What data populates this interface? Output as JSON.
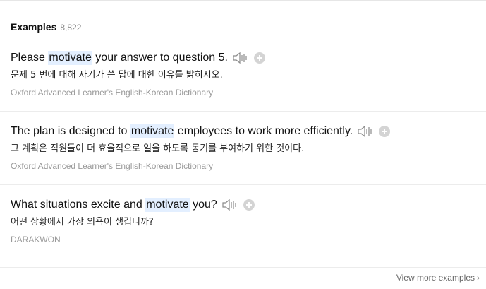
{
  "header": {
    "title": "Examples",
    "count": "8,822"
  },
  "examples": [
    {
      "before": "Please ",
      "highlight": "motivate",
      "after": " your answer to question 5.",
      "translation": "문제 5 번에 대해 자기가 쓴 답에 대한 이유를 밝히시오.",
      "source": "Oxford Advanced Learner's English-Korean Dictionary"
    },
    {
      "before": "The plan is designed to ",
      "highlight": "motivate",
      "after": " employees to work more efficiently.",
      "translation": "그 계획은 직원들이 더 효율적으로 일을 하도록 동기를 부여하기 위한 것이다.",
      "source": "Oxford Advanced Learner's English-Korean Dictionary"
    },
    {
      "before": "What situations excite and ",
      "highlight": "motivate",
      "after": " you?",
      "translation": "어떤 상황에서 가장 의욕이 생깁니까?",
      "source": "DARAKWON"
    }
  ],
  "footer": {
    "view_more": "View more examples"
  },
  "icons": {
    "speaker": "speaker-icon",
    "add": "plus-circle-icon",
    "chevron": "chevron-right-icon"
  },
  "colors": {
    "highlight": "#e3efff",
    "source_text": "#999999",
    "divider": "#ececec"
  }
}
